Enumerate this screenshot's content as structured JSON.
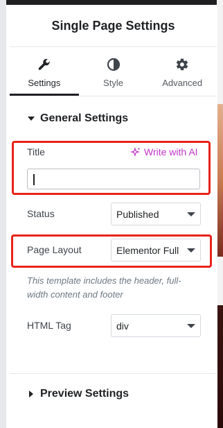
{
  "panel": {
    "title": "Single Page Settings"
  },
  "tabs": [
    {
      "label": "Settings",
      "icon": "wrench-icon",
      "active": true
    },
    {
      "label": "Style",
      "icon": "half-circle-icon",
      "active": false
    },
    {
      "label": "Advanced",
      "icon": "gear-icon",
      "active": false
    }
  ],
  "general": {
    "heading": "General Settings",
    "title_label": "Title",
    "write_ai_label": "Write with AI",
    "title_value": "",
    "status_label": "Status",
    "status_value": "Published",
    "layout_label": "Page Layout",
    "layout_value": "Elementor Full",
    "layout_hint": "This template includes the header, full-width content and footer",
    "tag_label": "HTML Tag",
    "tag_value": "div"
  },
  "preview": {
    "heading": "Preview Settings"
  },
  "colors": {
    "highlight": "#e8231a",
    "ai_accent": "#c236c9",
    "text": "#1f2124"
  }
}
